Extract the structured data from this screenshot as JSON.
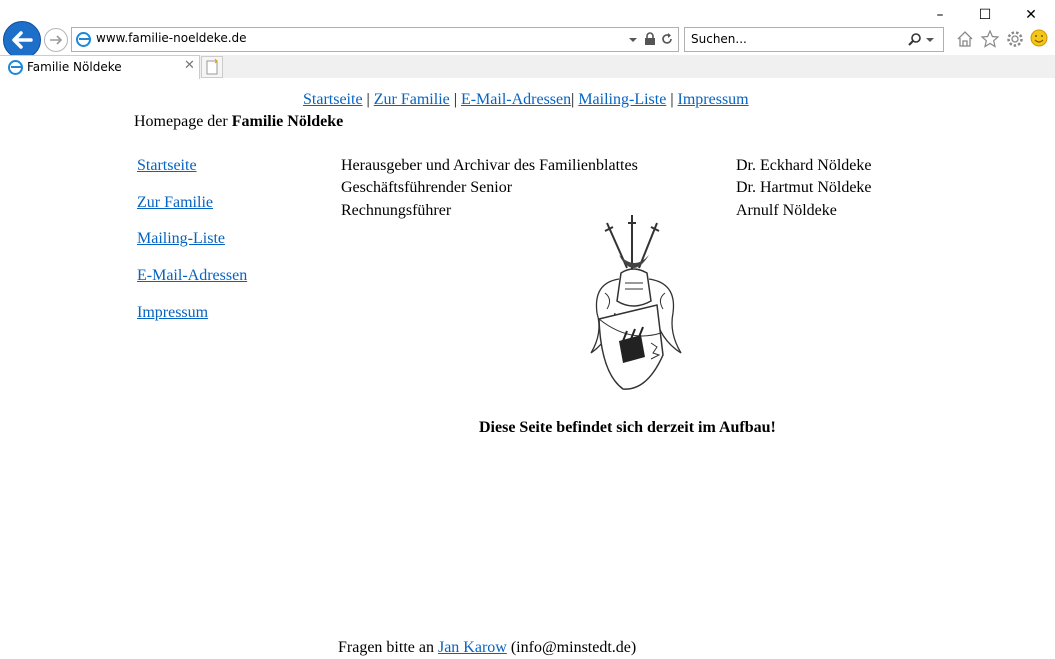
{
  "browser": {
    "url": "www.familie-noeldeke.de",
    "search_placeholder": "Suchen...",
    "tab_title": "Familie Nöldeke",
    "window_controls": {
      "minimize": "–",
      "maximize": "☐",
      "close": "✕"
    },
    "icons": [
      "back-icon",
      "forward-icon",
      "lock-icon",
      "refresh-icon",
      "search-icon",
      "home-icon",
      "star-icon",
      "gear-icon",
      "smiley-icon"
    ]
  },
  "topnav": {
    "items": [
      "Startseite",
      "Zur Familie",
      "E-Mail-Adressen",
      "Mailing-Liste",
      "Impressum"
    ],
    "separator": "|"
  },
  "header": {
    "prefix": "Homepage der ",
    "family": "Familie Nöldeke"
  },
  "sidebar": {
    "items": [
      "Startseite",
      "Zur Familie",
      "Mailing-Liste",
      "E-Mail-Adressen",
      "Impressum"
    ]
  },
  "officers": [
    {
      "role": "Herausgeber und Archivar des Familienblattes",
      "name": "Dr. Eckhard Nöldeke"
    },
    {
      "role": "Geschäftsführender Senior",
      "name": "Dr. Hartmut Nöldeke"
    },
    {
      "role": "Rechnungsführer",
      "name": "Arnulf Nöldeke"
    }
  ],
  "notice": "Diese Seite befindet sich derzeit im Aufbau!",
  "footer": {
    "prefix": "Fragen bitte an ",
    "link": "Jan Karow",
    "suffix": " (info@minstedt.de)"
  },
  "colors": {
    "link": "#0563c1",
    "back_button": "#1e6fc9"
  }
}
